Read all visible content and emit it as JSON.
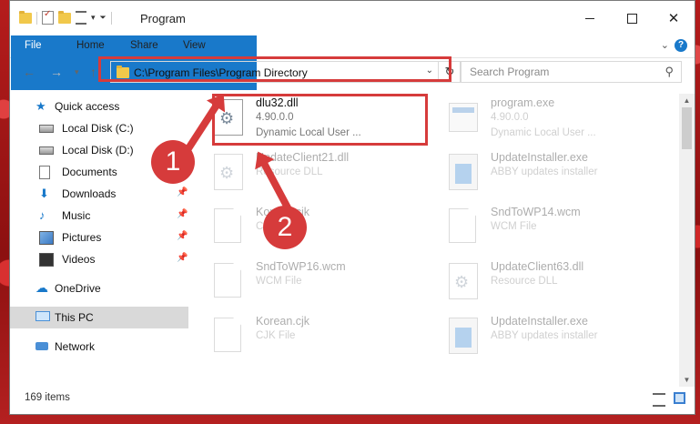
{
  "window": {
    "title": "Program"
  },
  "ribbon": {
    "tabs": [
      "File",
      "Home",
      "Share",
      "View"
    ]
  },
  "address": {
    "path": "C:\\Program Files\\Program Directory"
  },
  "search": {
    "placeholder": "Search Program"
  },
  "sidebar": {
    "items": [
      {
        "label": "Quick access",
        "icon": "star-icon"
      },
      {
        "label": "Local Disk (C:)",
        "icon": "disk-icon"
      },
      {
        "label": "Local Disk (D:)",
        "icon": "disk-icon"
      },
      {
        "label": "Documents",
        "icon": "documents-icon"
      },
      {
        "label": "Downloads",
        "icon": "downloads-icon"
      },
      {
        "label": "Music",
        "icon": "music-icon"
      },
      {
        "label": "Pictures",
        "icon": "pictures-icon"
      },
      {
        "label": "Videos",
        "icon": "videos-icon"
      },
      {
        "label": "OneDrive",
        "icon": "onedrive-icon"
      },
      {
        "label": "This PC",
        "icon": "this-pc-icon"
      },
      {
        "label": "Network",
        "icon": "network-icon"
      }
    ]
  },
  "files": [
    {
      "name": "dlu32.dll",
      "line1": "4.90.0.0",
      "line2": "Dynamic Local User ..."
    },
    {
      "name": "program.exe",
      "line1": "4.90.0.0",
      "line2": "Dynamic Local User ..."
    },
    {
      "name": "UpdateClient21.dll",
      "line1": "Resource DLL",
      "line2": ""
    },
    {
      "name": "UpdateInstaller.exe",
      "line1": "ABBY updates installer",
      "line2": ""
    },
    {
      "name": "Korean.cjk",
      "line1": "CJK File",
      "line2": ""
    },
    {
      "name": "SndToWP14.wcm",
      "line1": "WCM File",
      "line2": ""
    },
    {
      "name": "SndToWP16.wcm",
      "line1": "WCM File",
      "line2": ""
    },
    {
      "name": "UpdateClient63.dll",
      "line1": "Resource DLL",
      "line2": ""
    },
    {
      "name": "Korean.cjk",
      "line1": "CJK File",
      "line2": ""
    },
    {
      "name": "UpdateInstaller.exe",
      "line1": "ABBY updates installer",
      "line2": ""
    }
  ],
  "status": {
    "count": "169 items"
  },
  "annotations": {
    "badge1": "1",
    "badge2": "2",
    "color": "#d63b3b"
  }
}
